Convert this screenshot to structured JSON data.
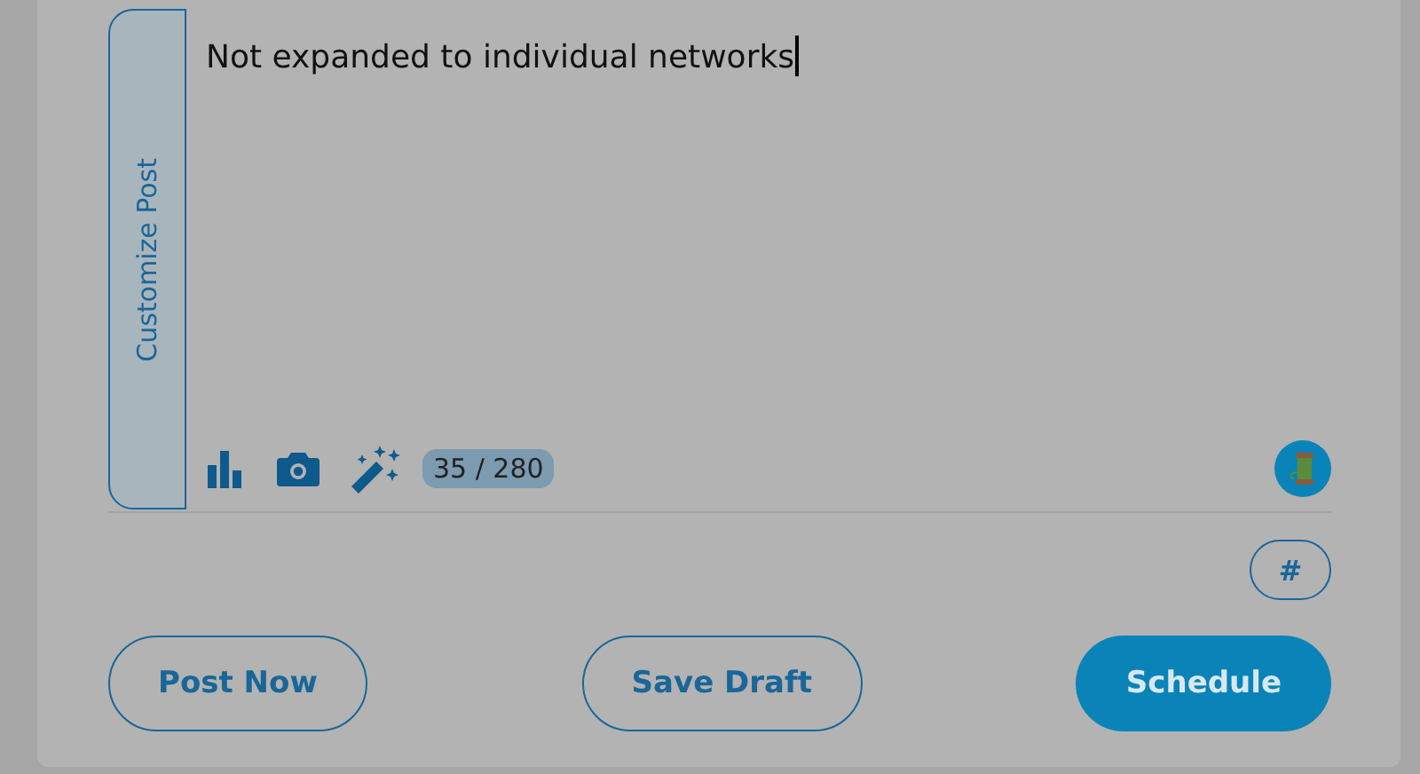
{
  "side_tab": {
    "label": "Customize Post"
  },
  "post": {
    "value": "Not expanded to individual networks",
    "focused": true,
    "char_count": "35 / 280"
  },
  "hashtag_button": {
    "label": "#"
  },
  "buttons": [
    {
      "label": "Post Now",
      "kind": "outline"
    },
    {
      "label": "Save Draft",
      "kind": "outline"
    },
    {
      "label": "Schedule",
      "kind": "primary"
    }
  ]
}
